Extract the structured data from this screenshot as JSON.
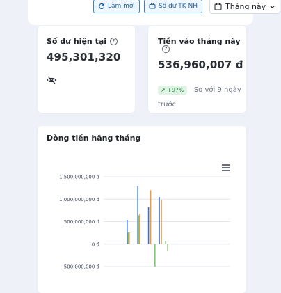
{
  "toolbar": {
    "refresh_label": "Làm mới",
    "bank_balance_label": "Số dư TK NH",
    "period_select_value": "Tháng này",
    "accent": "#3b82c4"
  },
  "balance_card": {
    "title": "Số dư hiện tại",
    "value": "495,301,320"
  },
  "income_card": {
    "title": "Tiền vào tháng này",
    "value": "536,960,007 đ",
    "change_badge": "↗ +97%",
    "compare_text": "So với 9 ngày trước"
  },
  "chart_card": {
    "title": "Dòng tiền hằng tháng"
  },
  "chart_data": {
    "type": "bar",
    "ytick_labels": [
      "1,500,000,000 đ",
      "1,000,000,000 đ",
      "500,000,000 đ",
      "0 đ",
      "-500,000,000 đ"
    ],
    "ylim": [
      -500000000,
      1500000000
    ],
    "grid": true,
    "series": [
      {
        "color": "#3a6fd8",
        "values": [
          540000000,
          0,
          1300000000,
          0,
          820000000,
          0,
          1050000000,
          0
        ]
      },
      {
        "color": "#7ac96c",
        "values": [
          260000000,
          0,
          640000000,
          0,
          0,
          -500000000,
          0,
          70000000
        ]
      },
      {
        "color": "#f29a3c",
        "values": [
          260000000,
          0,
          680000000,
          0,
          1200000000,
          0,
          980000000,
          0
        ]
      },
      {
        "color": "#8fb27a",
        "values": [
          0,
          0,
          0,
          0,
          0,
          0,
          0,
          -150000000
        ]
      }
    ]
  }
}
